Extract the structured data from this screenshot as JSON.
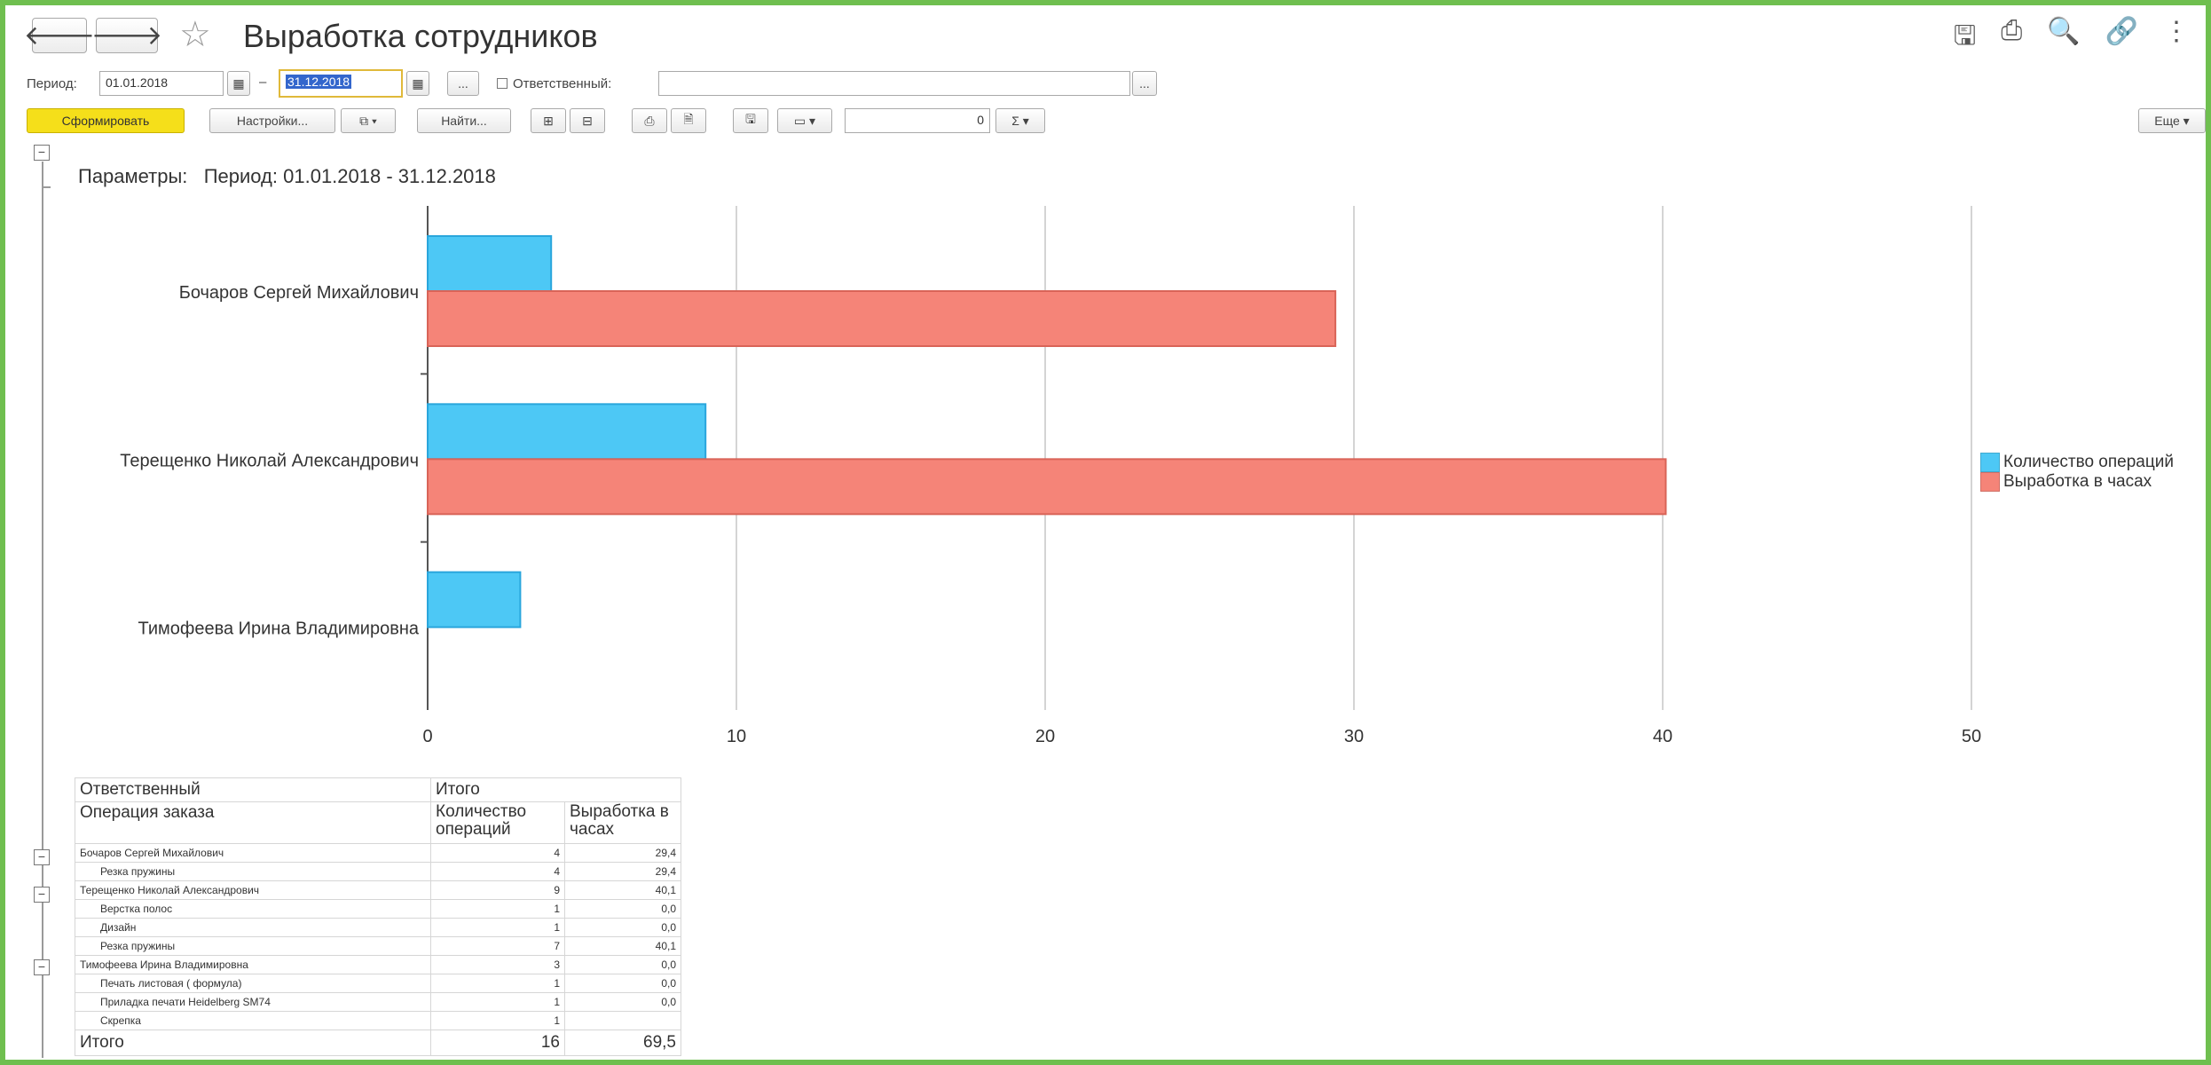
{
  "window": {
    "title": "Выработка сотрудников",
    "back_glyph": "🡐",
    "forward_glyph": "🡒",
    "star_glyph": "☆",
    "toolbar_icons": [
      {
        "name": "save-icon",
        "glyph": "🖫"
      },
      {
        "name": "print-icon",
        "glyph": "⎙"
      },
      {
        "name": "preview-icon",
        "glyph": "🔍"
      },
      {
        "name": "link-icon",
        "glyph": "🔗"
      },
      {
        "name": "more-icon",
        "glyph": "⋮"
      }
    ]
  },
  "period_row": {
    "label": "Период:",
    "date_from": "01.01.2018",
    "dash": "–",
    "date_to": "31.12.2018",
    "calendar_glyph": "▦",
    "select_btn": "...",
    "responsible_label": "Ответственный:",
    "responsible_value": "",
    "responsible_select": "..."
  },
  "toolbar": {
    "generate": "Сформировать",
    "settings": "Настройки...",
    "variants_glyph": "⧉ ▾",
    "find": "Найти...",
    "expand_glyph": "⊞",
    "collapse_glyph": "⊟",
    "print_glyph": "⎙",
    "preview_glyph": "🗎",
    "save_glyph": "🖫",
    "mode_glyph": "▭ ▾",
    "sum_value": "0",
    "sum_btn": "Σ ▾",
    "more": "Еще ▾"
  },
  "params": {
    "label": "Параметры:",
    "value": "Период: 01.01.2018 - 31.12.2018"
  },
  "colors": {
    "operations": "#4dc8f5",
    "operations_border": "#2aa6dc",
    "hours": "#f58478",
    "hours_border": "#d96458",
    "grid": "#d4d4d4",
    "axis": "#555555"
  },
  "chart_data": {
    "type": "bar",
    "orientation": "horizontal",
    "categories": [
      "Бочаров Сергей Михайлович",
      "Терещенко Николай Александрович",
      "Тимофеева Ирина Владимировна"
    ],
    "series": [
      {
        "name": "Количество операций",
        "values": [
          4,
          9,
          3
        ]
      },
      {
        "name": "Выработка в часах",
        "values": [
          29.4,
          40.1,
          0
        ]
      }
    ],
    "xlim": [
      0,
      50
    ],
    "xticks": [
      0,
      10,
      20,
      30,
      40,
      50
    ],
    "grid": true,
    "legend": "right"
  },
  "report_table": {
    "header1": [
      "Ответственный",
      "Итого"
    ],
    "header2": [
      "Операция заказа",
      "Количество операций",
      "Выработка в часах"
    ],
    "rows": [
      {
        "name": "Бочаров Сергей Михайлович",
        "qty": "4",
        "hours": "29,4",
        "level": 0
      },
      {
        "name": "Резка пружины",
        "qty": "4",
        "hours": "29,4",
        "level": 1
      },
      {
        "name": "Терещенко Николай Александрович",
        "qty": "9",
        "hours": "40,1",
        "level": 0
      },
      {
        "name": "Верстка полос",
        "qty": "1",
        "hours": "0,0",
        "level": 1
      },
      {
        "name": "Дизайн",
        "qty": "1",
        "hours": "0,0",
        "level": 1
      },
      {
        "name": "Резка пружины",
        "qty": "7",
        "hours": "40,1",
        "level": 1
      },
      {
        "name": "Тимофеева Ирина Владимировна",
        "qty": "3",
        "hours": "0,0",
        "level": 0
      },
      {
        "name": "Печать листовая ( формула)",
        "qty": "1",
        "hours": "0,0",
        "level": 1
      },
      {
        "name": "Приладка печати Heidelberg SM74",
        "qty": "1",
        "hours": "0,0",
        "level": 1
      },
      {
        "name": "Скрепка",
        "qty": "1",
        "hours": "",
        "level": 1
      }
    ],
    "total_label": "Итого",
    "total_qty": "16",
    "total_hours": "69,5"
  }
}
